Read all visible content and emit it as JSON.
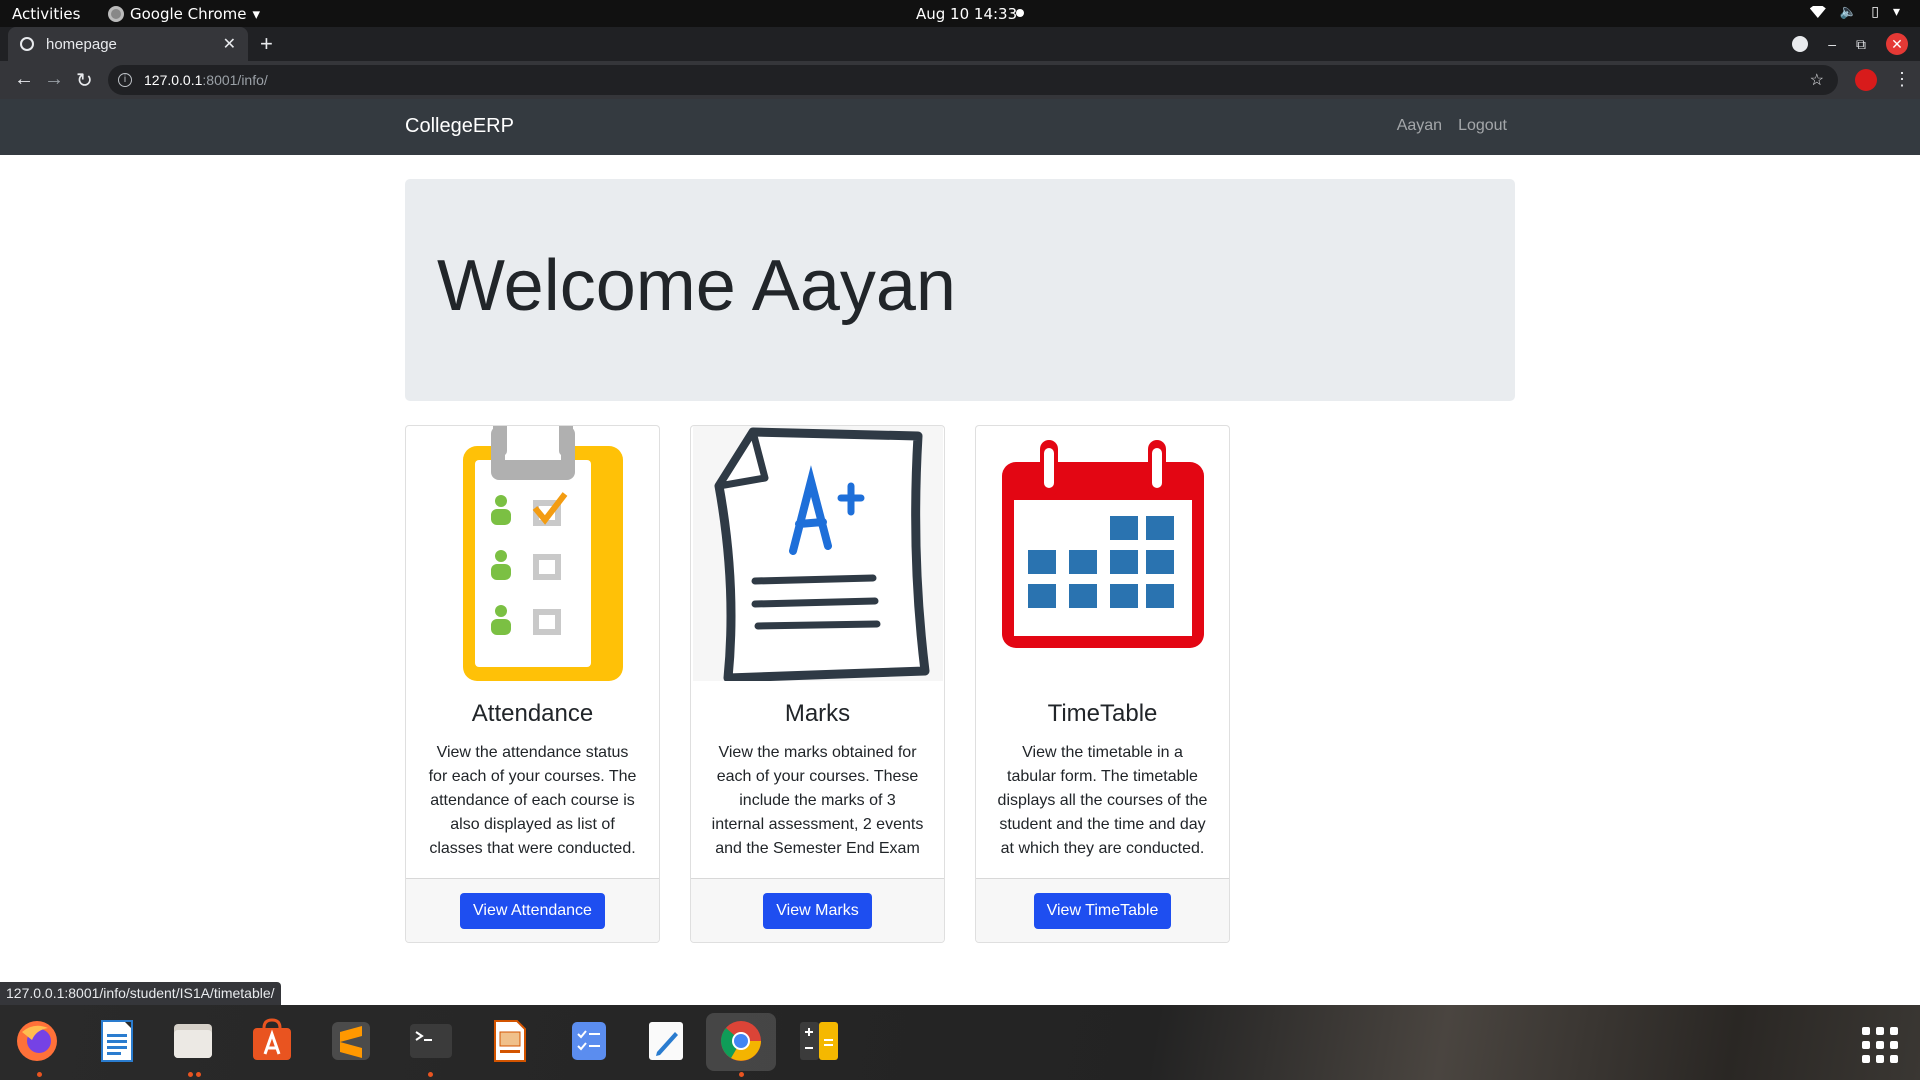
{
  "os_topbar": {
    "activities": "Activities",
    "app_name": "Google Chrome",
    "clock": "Aug 10  14:33"
  },
  "browser": {
    "tab_title": "homepage",
    "url_host": "127.0.0.1",
    "url_path": ":8001/info/",
    "status_url": "127.0.0.1:8001/info/student/IS1A/timetable/"
  },
  "navbar": {
    "brand": "CollegeERP",
    "user": "Aayan",
    "logout": "Logout"
  },
  "jumbotron": {
    "heading": "Welcome Aayan"
  },
  "cards": [
    {
      "title": "Attendance",
      "text": "View the attendance status for each of your courses. The attendance of each course is also displayed as list of classes that were conducted.",
      "button": "View Attendance"
    },
    {
      "title": "Marks",
      "text": "View the marks obtained for each of your courses. These include the marks of 3 internal assessment, 2 events and the Semester End Exam",
      "button": "View Marks"
    },
    {
      "title": "TimeTable",
      "text": "View the timetable in a tabular form. The timetable displays all the courses of the student and the time and day at which they are conducted.",
      "button": "View TimeTable"
    }
  ],
  "dock": {
    "apps": [
      "firefox-icon",
      "writer-icon",
      "files-icon",
      "software-icon",
      "sublime-icon",
      "terminal-icon",
      "impress-icon",
      "tasks-icon",
      "text-editor-icon",
      "chrome-icon",
      "calculator-icon"
    ]
  },
  "colors": {
    "navbar_bg": "#343a40",
    "jumbotron_bg": "#e9ecef",
    "button_primary": "#1e4ef0"
  }
}
